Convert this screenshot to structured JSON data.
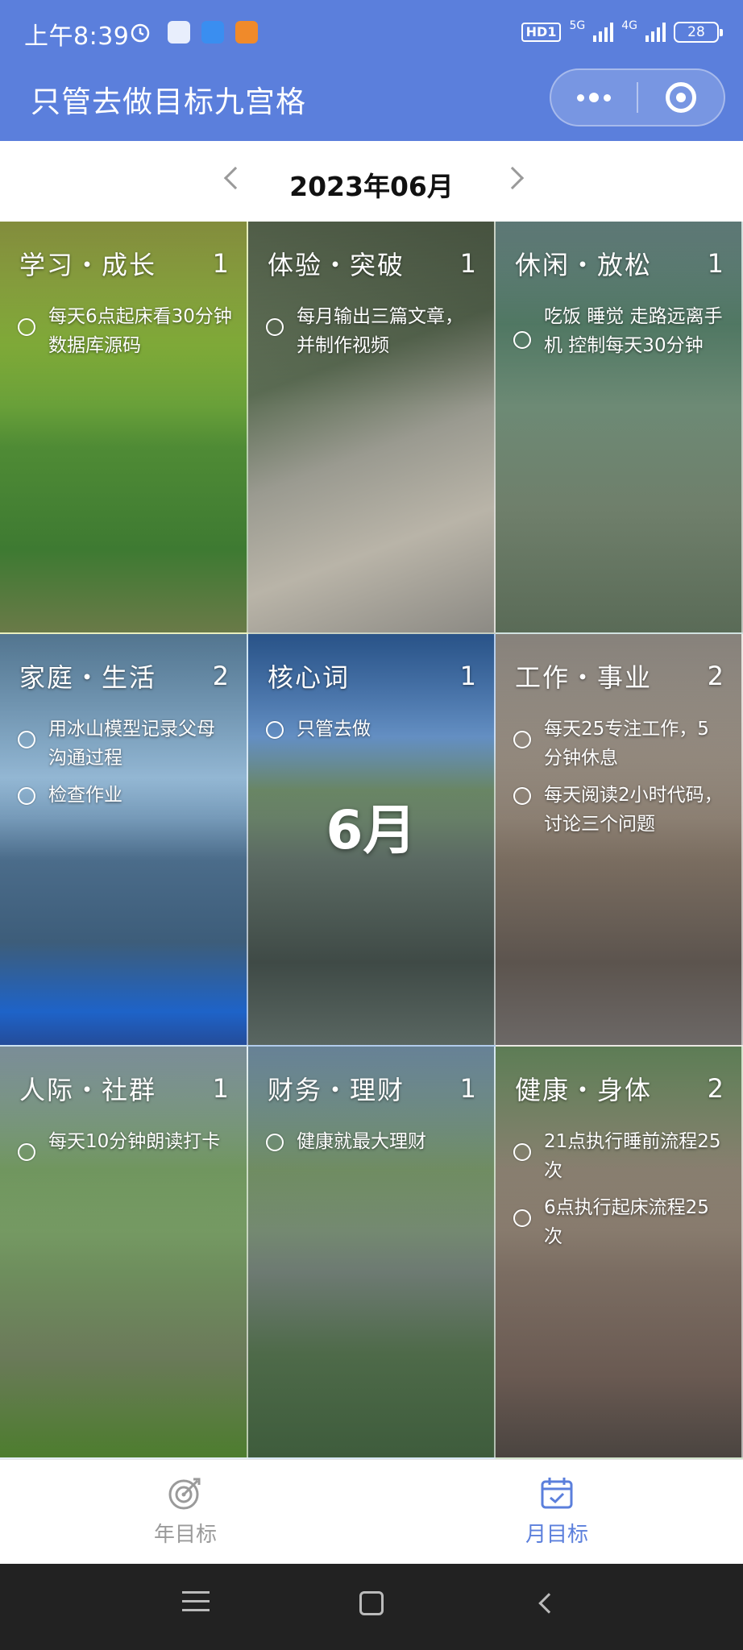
{
  "status_bar": {
    "time": "上午8:39",
    "hd_label": "HD1",
    "net1": "5G",
    "net2": "4G",
    "battery": "28"
  },
  "app": {
    "title": "只管去做目标九宫格"
  },
  "month_nav": {
    "label": "2023年06月"
  },
  "grid": {
    "cells": [
      {
        "name": "学习・成长",
        "count": "1",
        "tasks": [
          "每天6点起床看30分钟数据库源码"
        ]
      },
      {
        "name": "体验・突破",
        "count": "1",
        "tasks": [
          "每月输出三篇文章，并制作视频"
        ]
      },
      {
        "name": "休闲・放松",
        "count": "1",
        "tasks": [
          "吃饭 睡觉 走路远离手机 控制每天30分钟"
        ]
      },
      {
        "name": "家庭・生活",
        "count": "2",
        "tasks": [
          "用冰山模型记录父母沟通过程",
          "检查作业"
        ]
      },
      {
        "name": "核心词",
        "count": "1",
        "tasks": [
          "只管去做"
        ],
        "center_label": "6月"
      },
      {
        "name": "工作・事业",
        "count": "2",
        "tasks": [
          "每天25专注工作，5分钟休息",
          "每天阅读2小时代码，讨论三个问题"
        ]
      },
      {
        "name": "人际・社群",
        "count": "1",
        "tasks": [
          "每天10分钟朗读打卡"
        ]
      },
      {
        "name": "财务・理财",
        "count": "1",
        "tasks": [
          "健康就最大理财"
        ]
      },
      {
        "name": "健康・身体",
        "count": "2",
        "tasks": [
          "21点执行睡前流程25次",
          "6点执行起床流程25次"
        ]
      }
    ]
  },
  "tabbar": {
    "year_label": "年目标",
    "month_label": "月目标",
    "active": "month",
    "accent_color": "#5b7fdc"
  },
  "icons": {
    "status_alarm": "alarm-icon",
    "status_app1": "app-notification-icon",
    "status_app2": "chat-notification-icon",
    "status_app3": "game-notification-icon",
    "capsule_more": "more-dots-icon",
    "capsule_close": "target-close-icon",
    "year_tab": "target-arrow-icon",
    "month_tab": "calendar-check-icon"
  }
}
